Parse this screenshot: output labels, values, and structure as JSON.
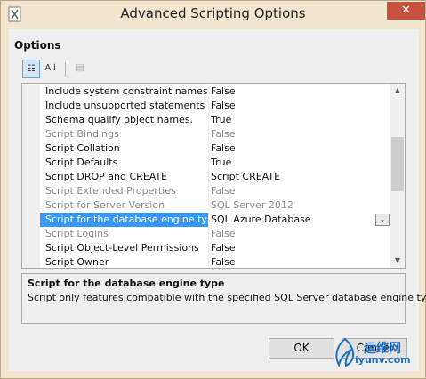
{
  "window": {
    "title": "Advanced Scripting Options",
    "close_glyph": "✕"
  },
  "section_label": "Options",
  "toolbar": {
    "categorized_glyph": "☷",
    "alphabetical_glyph": "A↓",
    "property_pages_glyph": "▤"
  },
  "grid": {
    "rows": [
      {
        "name": "Include system constraint names",
        "value": "False"
      },
      {
        "name": "Include unsupported statements",
        "value": "False"
      },
      {
        "name": "Schema qualify object names.",
        "value": "True"
      },
      {
        "name": "Script Bindings",
        "value": "False"
      },
      {
        "name": "Script Collation",
        "value": "False"
      },
      {
        "name": "Script Defaults",
        "value": "True"
      },
      {
        "name": "Script DROP and CREATE",
        "value": "Script CREATE"
      },
      {
        "name": "Script Extended Properties",
        "value": "False"
      },
      {
        "name": "Script for Server Version",
        "value": "SQL Server 2012"
      },
      {
        "name": "Script for the database engine type",
        "value": "SQL Azure Database"
      },
      {
        "name": "Script Logins",
        "value": "False"
      },
      {
        "name": "Script Object-Level Permissions",
        "value": "False"
      },
      {
        "name": "Script Owner",
        "value": "False"
      }
    ],
    "dropdown_glyph": "⌄",
    "scroll_up_glyph": "▲",
    "scroll_down_glyph": "▼"
  },
  "description": {
    "title": "Script for the database engine type",
    "text": "Script only features compatible with the specified SQL Server database engine type."
  },
  "buttons": {
    "ok": "OK",
    "cancel": "Cancel"
  },
  "watermark": {
    "chinese": "运维网",
    "url": "iyunv.com"
  },
  "colors": {
    "selection": "#3399ff",
    "dim_text": "#8d8d8d",
    "close_button": "#c7503f"
  }
}
